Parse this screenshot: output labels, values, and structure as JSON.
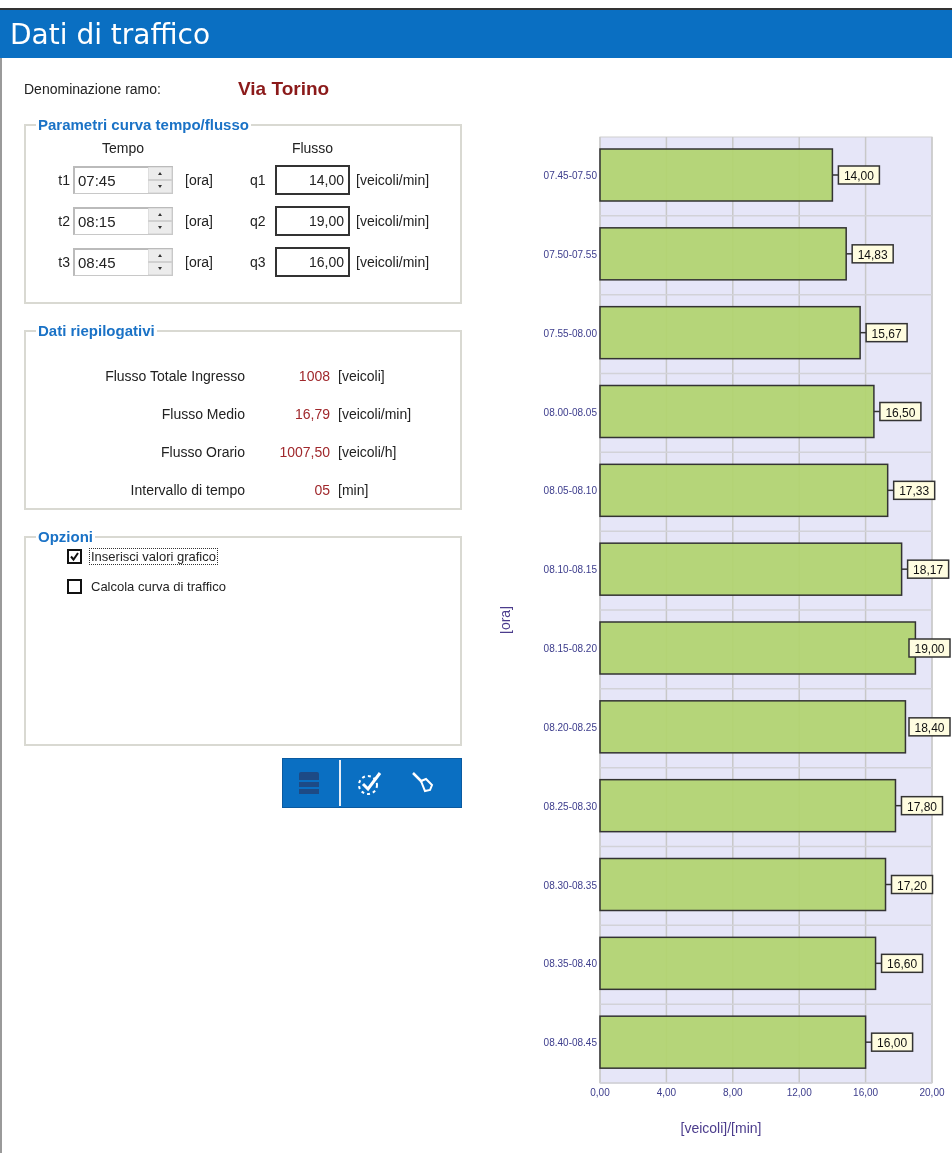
{
  "window": {
    "title": "Dati di traffico"
  },
  "branch": {
    "label": "Denominazione ramo:",
    "value": "Via Torino"
  },
  "parameters": {
    "title": "Parametri curva tempo/flusso",
    "time_heading": "Tempo",
    "flow_heading": "Flusso",
    "rows": [
      {
        "time_label": "t1",
        "time": "07:45",
        "time_unit": "[ora]",
        "flow_label": "q1",
        "flow": "14,00",
        "flow_unit": "[veicoli/min]"
      },
      {
        "time_label": "t2",
        "time": "08:15",
        "time_unit": "[ora]",
        "flow_label": "q2",
        "flow": "19,00",
        "flow_unit": "[veicoli/min]"
      },
      {
        "time_label": "t3",
        "time": "08:45",
        "time_unit": "[ora]",
        "flow_label": "q3",
        "flow": "16,00",
        "flow_unit": "[veicoli/min]"
      }
    ]
  },
  "summary": {
    "title": "Dati riepilogativi",
    "rows": [
      {
        "label": "Flusso Totale Ingresso",
        "value": "1008",
        "unit": "[veicoli]"
      },
      {
        "label": "Flusso Medio",
        "value": "16,79",
        "unit": "[veicoli/min]"
      },
      {
        "label": "Flusso Orario",
        "value": "1007,50",
        "unit": "[veicoli/h]"
      },
      {
        "label": "Intervallo di tempo",
        "value": "05",
        "unit": "[min]"
      }
    ]
  },
  "options": {
    "title": "Opzioni",
    "items": [
      {
        "label": "Inserisci valori grafico",
        "checked": true,
        "focused": true
      },
      {
        "label": "Calcola curva di traffico",
        "checked": false,
        "focused": false
      }
    ]
  },
  "chart": {
    "chart_data": {
      "type": "bar",
      "orientation": "horizontal",
      "xlabel": "[veicoli]/[min]",
      "ylabel": "[ora]",
      "categories": [
        "07.45-07.50",
        "07.50-07.55",
        "07.55-08.00",
        "08.00-08.05",
        "08.05-08.10",
        "08.10-08.15",
        "08.15-08.20",
        "08.20-08.25",
        "08.25-08.30",
        "08.30-08.35",
        "08.35-08.40",
        "08.40-08.45"
      ],
      "values": [
        14.0,
        14.83,
        15.67,
        16.5,
        17.33,
        18.17,
        19.0,
        18.4,
        17.8,
        17.2,
        16.6,
        16.0
      ],
      "value_labels": [
        "14,00",
        "14,83",
        "15,67",
        "16,50",
        "17,33",
        "18,17",
        "19,00",
        "18,40",
        "17,80",
        "17,20",
        "16,60",
        "16,00"
      ],
      "xlim": [
        0,
        20
      ],
      "grid": true,
      "xticks": [
        {
          "value": 0,
          "label": "0,00"
        },
        {
          "value": 4,
          "label": "4,00"
        },
        {
          "value": 8,
          "label": "8,00"
        },
        {
          "value": 12,
          "label": "12,00"
        },
        {
          "value": 16,
          "label": "16,00"
        },
        {
          "value": 20,
          "label": "20,00"
        }
      ]
    }
  }
}
